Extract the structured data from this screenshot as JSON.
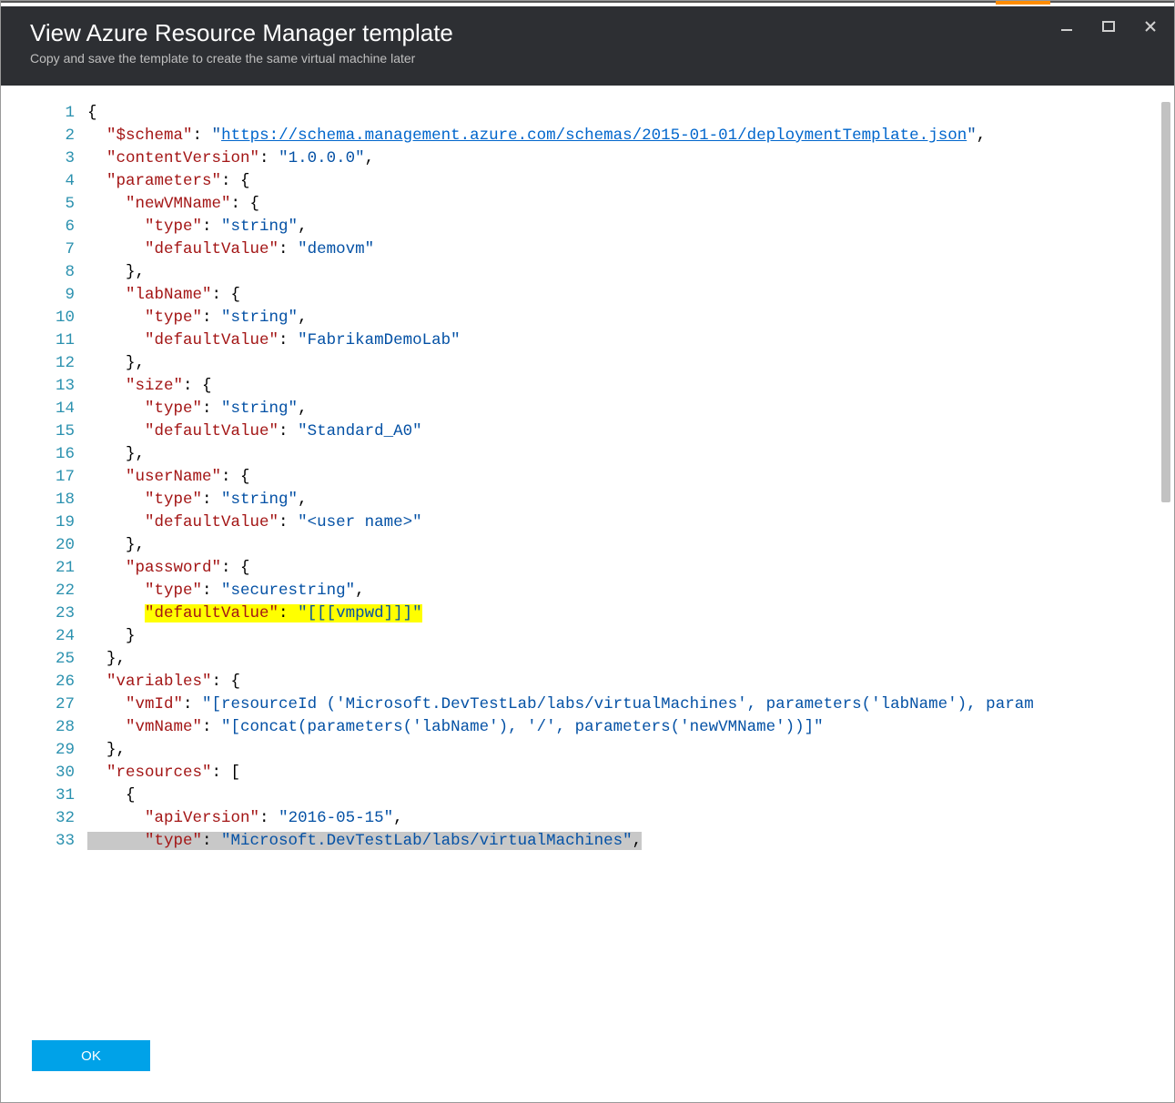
{
  "header": {
    "title": "View Azure Resource Manager template",
    "subtitle": "Copy and save the template to create the same virtual machine later"
  },
  "footer": {
    "ok_label": "OK"
  },
  "code": {
    "line_count": 33,
    "lines": [
      {
        "tokens": [
          {
            "t": "{",
            "c": "p"
          }
        ]
      },
      {
        "tokens": [
          {
            "t": "  ",
            "c": "p"
          },
          {
            "t": "\"$schema\"",
            "c": "k"
          },
          {
            "t": ": ",
            "c": "p"
          },
          {
            "t": "\"",
            "c": "s"
          },
          {
            "t": "https://schema.management.azure.com/schemas/2015-01-01/deploymentTemplate.json",
            "c": "lnk"
          },
          {
            "t": "\"",
            "c": "s"
          },
          {
            "t": ",",
            "c": "p"
          }
        ]
      },
      {
        "tokens": [
          {
            "t": "  ",
            "c": "p"
          },
          {
            "t": "\"contentVersion\"",
            "c": "k"
          },
          {
            "t": ": ",
            "c": "p"
          },
          {
            "t": "\"1.0.0.0\"",
            "c": "s"
          },
          {
            "t": ",",
            "c": "p"
          }
        ]
      },
      {
        "tokens": [
          {
            "t": "  ",
            "c": "p"
          },
          {
            "t": "\"parameters\"",
            "c": "k"
          },
          {
            "t": ": {",
            "c": "p"
          }
        ]
      },
      {
        "tokens": [
          {
            "t": "    ",
            "c": "p"
          },
          {
            "t": "\"newVMName\"",
            "c": "k"
          },
          {
            "t": ": {",
            "c": "p"
          }
        ]
      },
      {
        "tokens": [
          {
            "t": "      ",
            "c": "p"
          },
          {
            "t": "\"type\"",
            "c": "k"
          },
          {
            "t": ": ",
            "c": "p"
          },
          {
            "t": "\"string\"",
            "c": "s"
          },
          {
            "t": ",",
            "c": "p"
          }
        ]
      },
      {
        "tokens": [
          {
            "t": "      ",
            "c": "p"
          },
          {
            "t": "\"defaultValue\"",
            "c": "k"
          },
          {
            "t": ": ",
            "c": "p"
          },
          {
            "t": "\"demovm\"",
            "c": "s"
          }
        ]
      },
      {
        "tokens": [
          {
            "t": "    },",
            "c": "p"
          }
        ]
      },
      {
        "tokens": [
          {
            "t": "    ",
            "c": "p"
          },
          {
            "t": "\"labName\"",
            "c": "k"
          },
          {
            "t": ": {",
            "c": "p"
          }
        ]
      },
      {
        "tokens": [
          {
            "t": "      ",
            "c": "p"
          },
          {
            "t": "\"type\"",
            "c": "k"
          },
          {
            "t": ": ",
            "c": "p"
          },
          {
            "t": "\"string\"",
            "c": "s"
          },
          {
            "t": ",",
            "c": "p"
          }
        ]
      },
      {
        "tokens": [
          {
            "t": "      ",
            "c": "p"
          },
          {
            "t": "\"defaultValue\"",
            "c": "k"
          },
          {
            "t": ": ",
            "c": "p"
          },
          {
            "t": "\"FabrikamDemoLab\"",
            "c": "s"
          }
        ]
      },
      {
        "tokens": [
          {
            "t": "    },",
            "c": "p"
          }
        ]
      },
      {
        "tokens": [
          {
            "t": "    ",
            "c": "p"
          },
          {
            "t": "\"size\"",
            "c": "k"
          },
          {
            "t": ": {",
            "c": "p"
          }
        ]
      },
      {
        "tokens": [
          {
            "t": "      ",
            "c": "p"
          },
          {
            "t": "\"type\"",
            "c": "k"
          },
          {
            "t": ": ",
            "c": "p"
          },
          {
            "t": "\"string\"",
            "c": "s"
          },
          {
            "t": ",",
            "c": "p"
          }
        ]
      },
      {
        "tokens": [
          {
            "t": "      ",
            "c": "p"
          },
          {
            "t": "\"defaultValue\"",
            "c": "k"
          },
          {
            "t": ": ",
            "c": "p"
          },
          {
            "t": "\"Standard_A0\"",
            "c": "s"
          }
        ]
      },
      {
        "tokens": [
          {
            "t": "    },",
            "c": "p"
          }
        ]
      },
      {
        "tokens": [
          {
            "t": "    ",
            "c": "p"
          },
          {
            "t": "\"userName\"",
            "c": "k"
          },
          {
            "t": ": {",
            "c": "p"
          }
        ]
      },
      {
        "tokens": [
          {
            "t": "      ",
            "c": "p"
          },
          {
            "t": "\"type\"",
            "c": "k"
          },
          {
            "t": ": ",
            "c": "p"
          },
          {
            "t": "\"string\"",
            "c": "s"
          },
          {
            "t": ",",
            "c": "p"
          }
        ]
      },
      {
        "tokens": [
          {
            "t": "      ",
            "c": "p"
          },
          {
            "t": "\"defaultValue\"",
            "c": "k"
          },
          {
            "t": ": ",
            "c": "p"
          },
          {
            "t": "\"<user name>\"",
            "c": "s"
          }
        ]
      },
      {
        "tokens": [
          {
            "t": "    },",
            "c": "p"
          }
        ]
      },
      {
        "tokens": [
          {
            "t": "    ",
            "c": "p"
          },
          {
            "t": "\"password\"",
            "c": "k"
          },
          {
            "t": ": {",
            "c": "p"
          }
        ]
      },
      {
        "tokens": [
          {
            "t": "      ",
            "c": "p"
          },
          {
            "t": "\"type\"",
            "c": "k"
          },
          {
            "t": ": ",
            "c": "p"
          },
          {
            "t": "\"securestring\"",
            "c": "s"
          },
          {
            "t": ",",
            "c": "p"
          }
        ]
      },
      {
        "hl": true,
        "tokens": [
          {
            "t": "      ",
            "c": "p"
          },
          {
            "t": "\"defaultValue\"",
            "c": "k"
          },
          {
            "t": ": ",
            "c": "p"
          },
          {
            "t": "\"[[[vmpwd]]]\"",
            "c": "s"
          }
        ]
      },
      {
        "tokens": [
          {
            "t": "    }",
            "c": "p"
          }
        ]
      },
      {
        "tokens": [
          {
            "t": "  },",
            "c": "p"
          }
        ]
      },
      {
        "tokens": [
          {
            "t": "  ",
            "c": "p"
          },
          {
            "t": "\"variables\"",
            "c": "k"
          },
          {
            "t": ": {",
            "c": "p"
          }
        ]
      },
      {
        "tokens": [
          {
            "t": "    ",
            "c": "p"
          },
          {
            "t": "\"vmId\"",
            "c": "k"
          },
          {
            "t": ": ",
            "c": "p"
          },
          {
            "t": "\"[resourceId ('Microsoft.DevTestLab/labs/virtualMachines', parameters('labName'), param",
            "c": "s"
          }
        ]
      },
      {
        "tokens": [
          {
            "t": "    ",
            "c": "p"
          },
          {
            "t": "\"vmName\"",
            "c": "k"
          },
          {
            "t": ": ",
            "c": "p"
          },
          {
            "t": "\"[concat(parameters('labName'), '/', parameters('newVMName'))]\"",
            "c": "s"
          }
        ]
      },
      {
        "tokens": [
          {
            "t": "  },",
            "c": "p"
          }
        ]
      },
      {
        "tokens": [
          {
            "t": "  ",
            "c": "p"
          },
          {
            "t": "\"resources\"",
            "c": "k"
          },
          {
            "t": ": [",
            "c": "p"
          }
        ]
      },
      {
        "tokens": [
          {
            "t": "    {",
            "c": "p"
          }
        ]
      },
      {
        "tokens": [
          {
            "t": "      ",
            "c": "p"
          },
          {
            "t": "\"apiVersion\"",
            "c": "k"
          },
          {
            "t": ": ",
            "c": "p"
          },
          {
            "t": "\"2016-05-15\"",
            "c": "s"
          },
          {
            "t": ",",
            "c": "p"
          }
        ]
      },
      {
        "sel": true,
        "tokens": [
          {
            "t": "      ",
            "c": "p"
          },
          {
            "t": "\"type\"",
            "c": "k"
          },
          {
            "t": ": ",
            "c": "p"
          },
          {
            "t": "\"Microsoft.DevTestLab/labs/virtualMachines\"",
            "c": "s"
          },
          {
            "t": ",",
            "c": "p"
          }
        ]
      }
    ]
  }
}
